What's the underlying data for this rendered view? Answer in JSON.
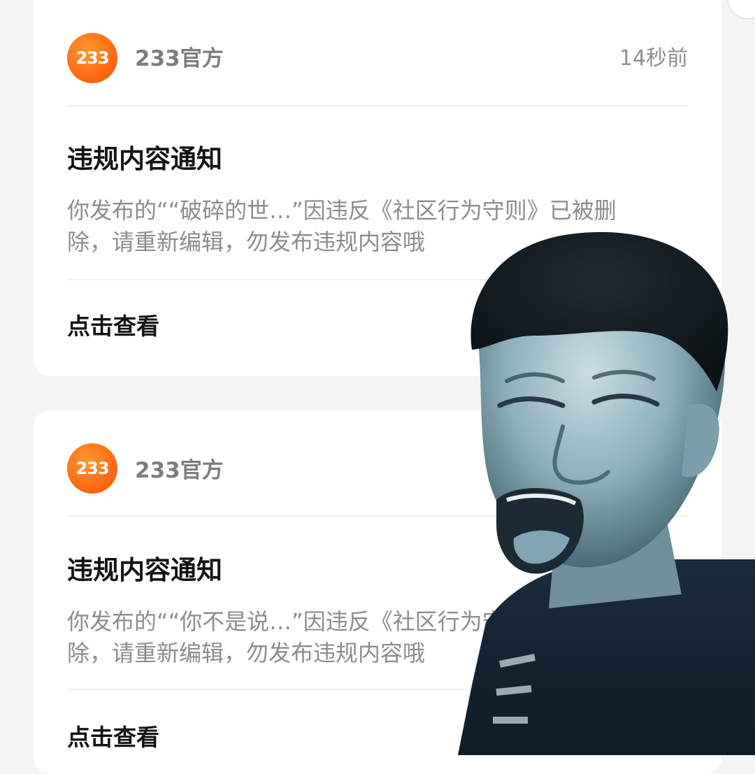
{
  "notifications": [
    {
      "sender": "233官方",
      "logo_text": "233",
      "time": "14秒前",
      "title": "违规内容通知",
      "body_line1": "你发布的““破碎的世…”因违反《社区行为守则》已被删",
      "body_line2": "除，请重新编辑，勿发布违规内容哦",
      "action": "点击查看"
    },
    {
      "sender": "233官方",
      "logo_text": "233",
      "time": "",
      "title": "违规内容通知",
      "body_line1": "你发布的““你不是说…”因违反《社区行为守则》已被删",
      "body_line2": "除，请重新编辑，勿发布违规内容哦",
      "action": "点击查看"
    }
  ],
  "colors": {
    "accent": "#ff6a14",
    "background": "#f4f4f4",
    "card": "#ffffff",
    "title_text": "#141414",
    "secondary_text": "#8c8c8c"
  },
  "overlay": {
    "icon": "crying-man-meme-sticker"
  }
}
